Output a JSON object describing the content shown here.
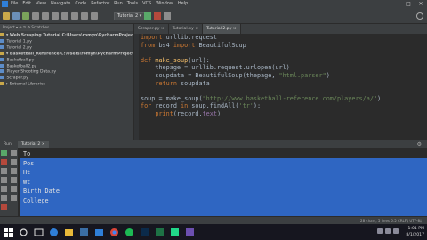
{
  "menu": [
    "File",
    "Edit",
    "View",
    "Navigate",
    "Code",
    "Refactor",
    "Run",
    "Tools",
    "VCS",
    "Window",
    "Help"
  ],
  "toolbar": {
    "run_config": "Tutorial 2 ▾"
  },
  "project_panel": {
    "header": "Project ▾  ⊕  ⇅  ⚙  Scratches",
    "tree": [
      {
        "label": "▾ Web Scraping Tutorial  C:\\Users\\romyn\\PycharmProjects\\Web...",
        "kind": "folder",
        "bold": true
      },
      {
        "label": "    Tutorial 1.py",
        "kind": "file"
      },
      {
        "label": "    Tutorial 2.py",
        "kind": "file"
      },
      {
        "label": "▾ Basketball_Reference  C:\\Users\\romyn\\PycharmProjects\\Basketb...",
        "kind": "folder",
        "bold": true
      },
      {
        "label": "    Basketball.py",
        "kind": "file"
      },
      {
        "label": "    Basketball2.py",
        "kind": "file"
      },
      {
        "label": "    Player Shooting Data.py",
        "kind": "file"
      },
      {
        "label": "    Scraper.py",
        "kind": "file"
      },
      {
        "label": "▸ External Libraries",
        "kind": "folder",
        "bold": false
      }
    ]
  },
  "editor": {
    "tabs": [
      {
        "label": "Scraper.py ×",
        "active": false
      },
      {
        "label": "Tutorial.py ×",
        "active": false
      },
      {
        "label": "Tutorial 2.py ×",
        "active": true
      }
    ],
    "code": [
      [
        {
          "t": "import",
          "c": "kw"
        },
        {
          "t": " urllib.request",
          "c": "var"
        }
      ],
      [
        {
          "t": "from",
          "c": "kw"
        },
        {
          "t": " bs4 ",
          "c": "var"
        },
        {
          "t": "import",
          "c": "kw"
        },
        {
          "t": " BeautifulSoup",
          "c": "var"
        }
      ],
      [
        {
          "t": "",
          "c": "var"
        }
      ],
      [
        {
          "t": "def",
          "c": "kw"
        },
        {
          "t": " ",
          "c": "var"
        },
        {
          "t": "make_soup",
          "c": "fn"
        },
        {
          "t": "(url):",
          "c": "var"
        }
      ],
      [
        {
          "t": "    thepage = urllib.request.urlopen(url)",
          "c": "var"
        }
      ],
      [
        {
          "t": "    soupdata = BeautifulSoup(thepage, ",
          "c": "var"
        },
        {
          "t": "\"html.parser\"",
          "c": "str"
        },
        {
          "t": ")",
          "c": "var"
        }
      ],
      [
        {
          "t": "    ",
          "c": "var"
        },
        {
          "t": "return",
          "c": "kw"
        },
        {
          "t": " soupdata",
          "c": "var"
        }
      ],
      [
        {
          "t": "",
          "c": "var"
        }
      ],
      [
        {
          "t": "soup = make_soup(",
          "c": "var"
        },
        {
          "t": "\"http://www.basketball-reference.com/players/a/\"",
          "c": "str"
        },
        {
          "t": ")",
          "c": "var"
        }
      ],
      [
        {
          "t": "for",
          "c": "kw"
        },
        {
          "t": " record ",
          "c": "var"
        },
        {
          "t": "in",
          "c": "kw"
        },
        {
          "t": " soup.findAll(",
          "c": "var"
        },
        {
          "t": "'tr'",
          "c": "str"
        },
        {
          "t": "):",
          "c": "var"
        }
      ],
      [
        {
          "t": "    ",
          "c": "var"
        },
        {
          "t": "print",
          "c": "kw"
        },
        {
          "t": "(record.",
          "c": "var"
        },
        {
          "t": "text",
          "c": "selfv"
        },
        {
          "t": ")",
          "c": "var"
        }
      ]
    ]
  },
  "run_panel": {
    "label": "Run",
    "tab": "Tutorial 2 ×",
    "output_lines": [
      "To",
      "Pos",
      "Ht",
      "Wt",
      "Birth Date",
      "College"
    ]
  },
  "status": {
    "text": "28 chars, 5 lines   6:5   CRLF‡  UTF-8‡"
  },
  "taskbar": {
    "time": "1:01 PM",
    "date": "8/1/2017"
  },
  "colors": {
    "editor_bg": "#2b2b2b",
    "panel_bg": "#3c3f41",
    "keyword": "#cc7832",
    "string": "#6a8759",
    "function": "#ffc66d",
    "selection": "#2f66c2"
  }
}
